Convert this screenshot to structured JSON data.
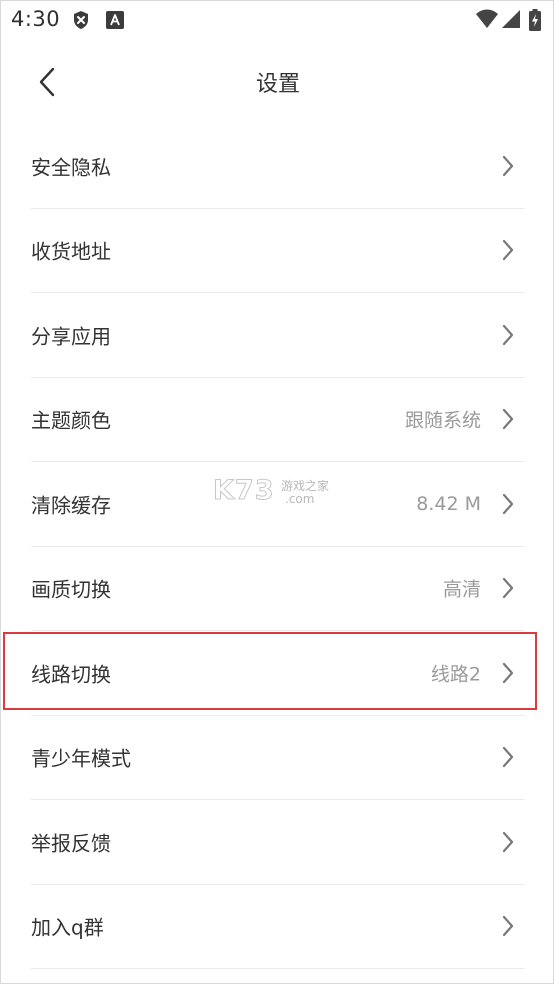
{
  "status_bar": {
    "time": "4:30",
    "left_icons": [
      "shield-x-icon",
      "text-a-icon"
    ],
    "right_icons": [
      "wifi-icon",
      "signal-icon",
      "battery-charging-icon"
    ]
  },
  "header": {
    "back_icon": "chevron-left-icon",
    "title": "设置"
  },
  "settings": {
    "items": [
      {
        "label": "安全隐私",
        "value": ""
      },
      {
        "label": "收货地址",
        "value": ""
      },
      {
        "label": "分享应用",
        "value": ""
      },
      {
        "label": "主题颜色",
        "value": "跟随系统"
      },
      {
        "label": "清除缓存",
        "value": "8.42 M"
      },
      {
        "label": "画质切换",
        "value": "高清"
      },
      {
        "label": "线路切换",
        "value": "线路2",
        "highlighted": true
      },
      {
        "label": "青少年模式",
        "value": ""
      },
      {
        "label": "举报反馈",
        "value": ""
      },
      {
        "label": "加入q群",
        "value": ""
      }
    ]
  },
  "watermark": {
    "main": "K73",
    "sub_cn": "游戏之家",
    "sub_com": ".com"
  },
  "colors": {
    "highlight_border": "#dc3b3e",
    "label_text": "#333333",
    "value_text": "#9a9a9a",
    "divider": "#ececec"
  }
}
